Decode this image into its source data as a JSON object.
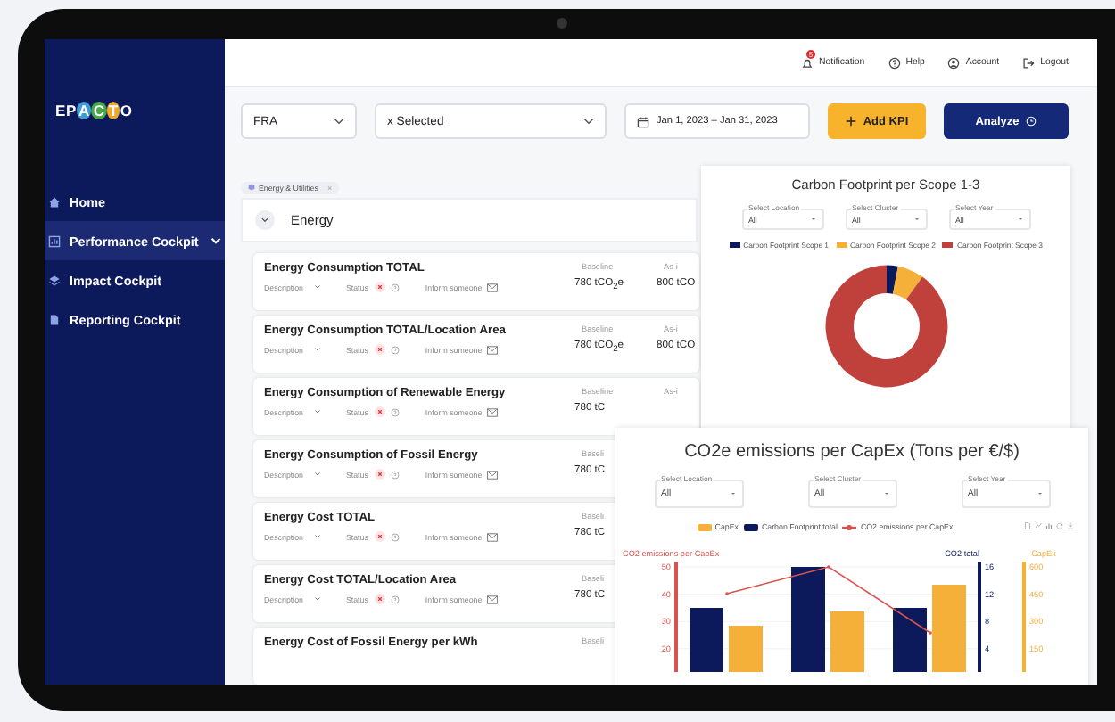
{
  "logo": [
    {
      "text": "EP"
    },
    {
      "text": "A",
      "color": "#3e9bd6"
    },
    {
      "text": "C",
      "color": "#47a84a"
    },
    {
      "text": "T",
      "color": "#f2a72b"
    },
    {
      "text": "O"
    }
  ],
  "sidebar": {
    "items": [
      {
        "label": "Home",
        "selected": false
      },
      {
        "label": "Performance Cockpit",
        "selected": true,
        "expanded": true
      },
      {
        "label": "Impact Cockpit",
        "selected": false
      },
      {
        "label": "Reporting Cockpit",
        "selected": false
      }
    ]
  },
  "header": {
    "items": [
      {
        "kind": "notification",
        "label": "Notification",
        "badge": "5"
      },
      {
        "kind": "help",
        "label": "Help"
      },
      {
        "kind": "account",
        "label": "Account"
      },
      {
        "kind": "logout",
        "label": "Logout"
      }
    ]
  },
  "toolbar": {
    "country": "FRA",
    "selection": "x Selected",
    "date_range": "Jan 1, 2023 – Jan 31, 2023",
    "add_button": "Add KPI",
    "analyze_button": "Analyze"
  },
  "filter_chips": [
    {
      "label": "Energy & Utilities",
      "remove": "×"
    }
  ],
  "section": {
    "title": "Energy",
    "expanded": true
  },
  "kpis": [
    {
      "title": "Energy Consumption TOTAL",
      "details": {
        "description": "Description",
        "status": "Status",
        "inform": "Inform someone"
      },
      "columns": [
        {
          "label": "Baseline",
          "value": "780 tCO$_{2}$e"
        },
        {
          "label": "As-i",
          "value": "800 tCO"
        }
      ]
    },
    {
      "title": "Energy Consumption TOTAL/Location Area",
      "details": {
        "description": "Description",
        "status": "Status",
        "inform": "Inform someone"
      },
      "columns": [
        {
          "label": "Baseline",
          "value": "780 tCO$_{2}$e"
        },
        {
          "label": "As-i",
          "value": "800 tCO"
        }
      ]
    },
    {
      "title": "Energy Consumption of Renewable Energy",
      "details": {
        "description": "Description",
        "status": "Status",
        "inform": "Inform someone"
      },
      "columns": [
        {
          "label": "Baseline",
          "value": "780 tC"
        },
        {
          "label": "As-i"
        }
      ]
    },
    {
      "title": "Energy Consumption of Fossil Energy",
      "details": {
        "description": "Description",
        "status": "Status",
        "inform": "Inform someone"
      },
      "columns": [
        {
          "label": "Baseli",
          "value": "780 tC"
        }
      ]
    },
    {
      "title": "Energy Cost TOTAL",
      "details": {
        "description": "Description",
        "status": "Status",
        "inform": "Inform someone"
      },
      "columns": [
        {
          "label": "Baseli",
          "value": "780 tC"
        }
      ]
    },
    {
      "title": "Energy Cost TOTAL/Location Area",
      "details": {
        "description": "Description",
        "status": "Status",
        "inform": "Inform someone"
      },
      "columns": [
        {
          "label": "Baseli",
          "value": "780 tC"
        }
      ]
    },
    {
      "title": "Energy Cost of Fossil Energy per kWh",
      "columns": [
        {
          "label": "Baseli"
        }
      ]
    }
  ],
  "scope_card": {
    "title": "Carbon Footprint per Scope 1-3",
    "filters": [
      {
        "label": "Select Location",
        "value": "All"
      },
      {
        "label": "Select Cluster",
        "value": "All"
      },
      {
        "label": "Select Year",
        "value": "All"
      }
    ],
    "legend": [
      {
        "label": "Carbon Footprint Scope 1",
        "color": "#0c1a5b"
      },
      {
        "label": "Carbon Footprint Scope 2",
        "color": "#f5b03a"
      },
      {
        "label": "Carbon Footprint Scope 3",
        "color": "#c0413b"
      }
    ]
  },
  "capex_card": {
    "title": "CO2e emissions per CapEx (Tons per €/$)",
    "filters": [
      {
        "label": "Select Location",
        "value": "All"
      },
      {
        "label": "Select Cluster",
        "value": "All"
      },
      {
        "label": "Select Year",
        "value": "All"
      }
    ],
    "legend": [
      {
        "label": "CapEx",
        "color": "#f5b03a",
        "kind": "bar"
      },
      {
        "label": "Carbon Footprint total",
        "color": "#0c1a5b",
        "kind": "bar"
      },
      {
        "label": "CO2 emissions per CapEx",
        "color": "#d9534f",
        "kind": "line"
      }
    ],
    "axes": [
      {
        "title": "CO2 emissions per CapEx",
        "color": "#d9534f",
        "ticks": [
          "50",
          "40",
          "30",
          "20"
        ]
      },
      {
        "title": "CO2 total",
        "color": "#0c1a5b",
        "ticks": [
          "16",
          "12",
          "8",
          "4"
        ]
      },
      {
        "title": "CapEx",
        "color": "#f5b03a",
        "ticks": [
          "600",
          "450",
          "300",
          "150"
        ]
      }
    ]
  }
}
